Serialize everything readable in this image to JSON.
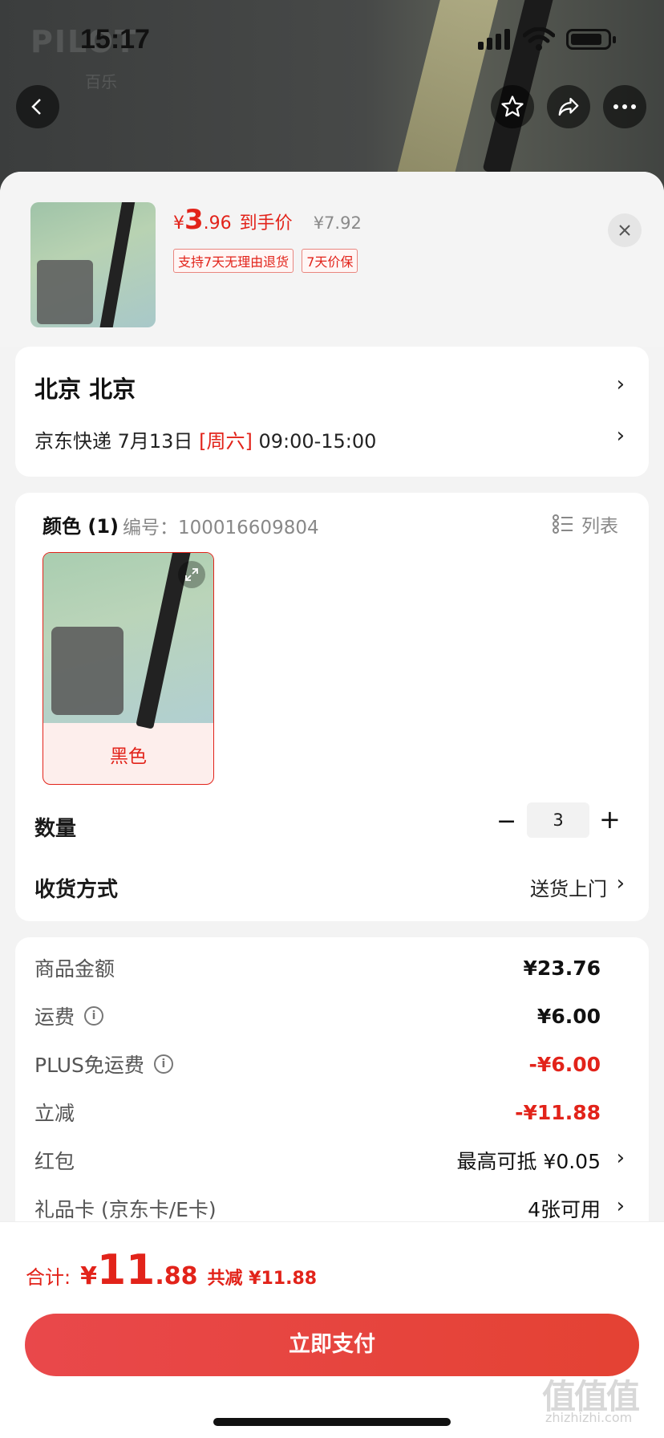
{
  "status_bar": {
    "time": "15:17"
  },
  "background": {
    "logo": "PILOT",
    "logo_sub": "百乐"
  },
  "product": {
    "price_symbol": "¥",
    "price_int": "3",
    "price_dec": ".96",
    "price_label": "到手价",
    "original_price": "¥7.92",
    "tags": [
      "支持7天无理由退货",
      "7天价保"
    ]
  },
  "address": {
    "city": "北京  北京",
    "delivery_prefix": "京东快递 7月13日 ",
    "delivery_day": "[周六]",
    "delivery_time": " 09:00-15:00"
  },
  "spec": {
    "title": "颜色 (1)",
    "sku": "编号：100016609804",
    "list_label": "列表",
    "variant_name": "黑色",
    "quantity_label": "数量",
    "quantity": "3",
    "shipping_label": "收货方式",
    "shipping_value": "送货上门"
  },
  "costs": [
    {
      "label": "商品金额",
      "value": "¥23.76",
      "info": false
    },
    {
      "label": "运费",
      "value": "¥6.00",
      "info": true
    },
    {
      "label": "PLUS免运费",
      "value": "-¥6.00",
      "info": true
    },
    {
      "label": "立减",
      "value": "-¥11.88",
      "info": false
    },
    {
      "label": "红包",
      "value": "最高可抵 ¥0.05",
      "info": false
    },
    {
      "label": "礼品卡 (京东卡/E卡)",
      "value": "4张可用",
      "info": false
    }
  ],
  "footer": {
    "total_label": "合计:",
    "total_symbol": "¥",
    "total_int": "11",
    "total_dec": ".88",
    "savings": "共减 ¥11.88",
    "pay_button": "立即支付"
  },
  "watermark": {
    "text": "值值值",
    "site": "zhizhizhi.com"
  },
  "colors": {
    "accent": "#e2231a",
    "pay_button": "#e5463b"
  }
}
